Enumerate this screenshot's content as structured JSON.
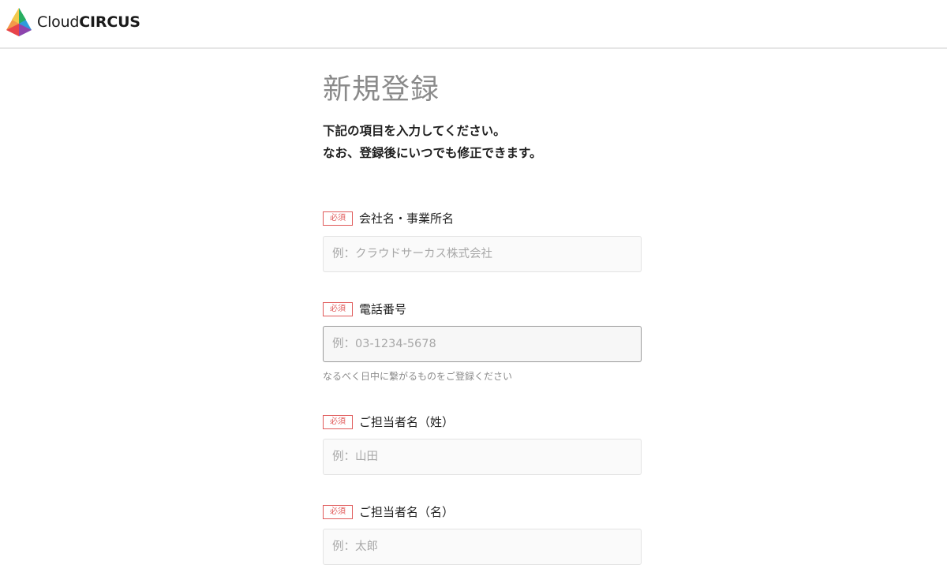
{
  "header": {
    "logo_light": "Cloud",
    "logo_bold": "CIRCUS",
    "logo_colors": [
      "#f5a623",
      "#e8434b",
      "#8e44ad",
      "#2d9cdb",
      "#27ae60",
      "#f2c94c"
    ]
  },
  "page": {
    "title": "新規登録",
    "intro_line1": "下記の項目を入力してください。",
    "intro_line2": "なお、登録後にいつでも修正できます。"
  },
  "form": {
    "required_badge": "必須",
    "company": {
      "label": "会社名・事業所名",
      "placeholder": "例：クラウドサーカス株式会社",
      "value": ""
    },
    "phone": {
      "label": "電話番号",
      "placeholder": "例：03-1234-5678",
      "value": "",
      "hint": "なるべく日中に繋がるものをご登録ください"
    },
    "last_name": {
      "label": "ご担当者名（姓）",
      "placeholder": "例：山田",
      "value": ""
    },
    "first_name": {
      "label": "ご担当者名（名）",
      "placeholder": "例：太郎",
      "value": ""
    }
  }
}
